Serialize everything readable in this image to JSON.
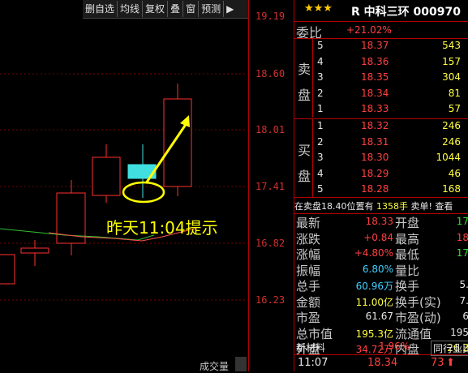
{
  "toolbar": {
    "items": [
      "删自选",
      "均线",
      "复权",
      "叠",
      "窗",
      "预测"
    ],
    "arrow": "▶"
  },
  "price_axis": [
    "19.19",
    "18.60",
    "18.01",
    "17.41",
    "16.82",
    "16.23"
  ],
  "annotation": "昨天11:04提示",
  "volume_label": "成交量",
  "quote": {
    "stars": "★★★",
    "title": "R 中科三环 000970",
    "weibi_label": "委比",
    "weibi_value": "+21.02%",
    "sell_label": [
      "卖",
      "盘"
    ],
    "buy_label": [
      "买",
      "盘"
    ],
    "sells": [
      {
        "level": "5",
        "price": "18.37",
        "vol": "543"
      },
      {
        "level": "4",
        "price": "18.36",
        "vol": "157"
      },
      {
        "level": "3",
        "price": "18.35",
        "vol": "304"
      },
      {
        "level": "2",
        "price": "18.34",
        "vol": "81"
      },
      {
        "level": "1",
        "price": "18.33",
        "vol": "57"
      }
    ],
    "buys": [
      {
        "level": "1",
        "price": "18.32",
        "vol": "246"
      },
      {
        "level": "2",
        "price": "18.31",
        "vol": "246"
      },
      {
        "level": "3",
        "price": "18.30",
        "vol": "1044"
      },
      {
        "level": "4",
        "price": "18.29",
        "vol": "46"
      },
      {
        "level": "5",
        "price": "18.28",
        "vol": "168"
      }
    ],
    "order_info": "在卖盘18.40位置有",
    "order_vol": "1358手",
    "order_tail": "卖单! 查看",
    "stats": [
      {
        "l1": "最新",
        "v1": "18.33",
        "l2": "开盘",
        "v2": "17"
      },
      {
        "l1": "涨跌",
        "v1": "+0.84",
        "l2": "最高",
        "v2": "18"
      },
      {
        "l1": "涨幅",
        "v1": "+4.80%",
        "l2": "最低",
        "v2": "17"
      },
      {
        "l1": "振幅",
        "v1": "6.80%",
        "l2": "量比",
        "v2": ""
      },
      {
        "l1": "总手",
        "v1": "60.96万",
        "l2": "换手",
        "v2": "5."
      },
      {
        "l1": "金额",
        "v1": "11.00亿",
        "l2": "换手(实)",
        "v2": "7."
      },
      {
        "l1": "市盈",
        "v1": "61.67",
        "l2": "市盈(动)",
        "v2": "6"
      },
      {
        "l1": "总市值",
        "v1": "195.3亿",
        "l2": "流通值",
        "v2": "195"
      },
      {
        "l1": "外盘",
        "v1": "34.72万",
        "l2": "内盘",
        "v2": "26.2"
      }
    ],
    "industry_label": "新材料",
    "industry_pct": "1.96%",
    "industry_btn": "同行业比",
    "tick_time": "11:07",
    "tick_price": "18.34",
    "tick_vol": "73"
  }
}
